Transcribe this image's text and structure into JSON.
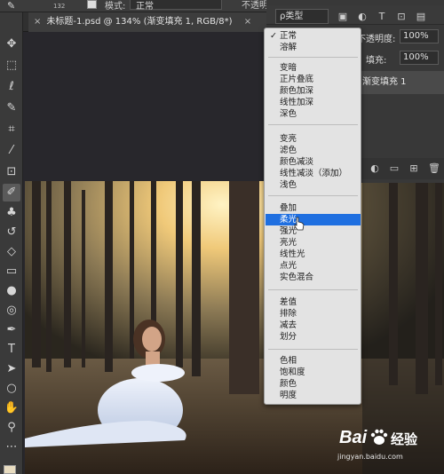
{
  "options_bar": {
    "brush_size": "132",
    "mode_label": "模式:",
    "mode_value": "正常",
    "right_label": "不透明"
  },
  "document_tab": {
    "close": "×",
    "title": "未标题-1.psd @ 134% (渐变填充 1, RGB/8*)",
    "close_right": "×"
  },
  "layers_panel": {
    "kind_filter": "ρ类型",
    "opacity_label": "不透明度:",
    "opacity_value": "100%",
    "fill_label": "填充:",
    "fill_value": "100%",
    "layer_name": "渐变填充 1"
  },
  "blend_menu": {
    "selected": "柔光",
    "groups": [
      [
        "正常",
        "溶解"
      ],
      [
        "变暗",
        "正片叠底",
        "颜色加深",
        "线性加深",
        "深色"
      ],
      [
        "变亮",
        "滤色",
        "颜色减淡",
        "线性减淡（添加）",
        "浅色"
      ],
      [
        "叠加",
        "柔光",
        "强光",
        "亮光",
        "线性光",
        "点光",
        "实色混合"
      ],
      [
        "差值",
        "排除",
        "减去",
        "划分"
      ],
      [
        "色相",
        "饱和度",
        "颜色",
        "明度"
      ]
    ],
    "check": "✓"
  },
  "watermark": {
    "logo": "Bai",
    "suffix": "经验",
    "url": "jingyan.baidu.com"
  },
  "colors": {
    "menu_highlight": "#1f6fe0",
    "panel": "#383838",
    "canvas_bg": "#28272c"
  }
}
